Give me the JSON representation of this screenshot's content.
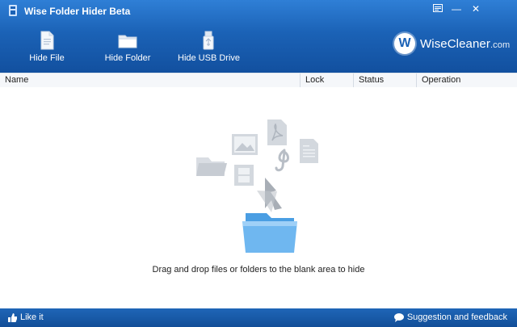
{
  "window": {
    "title": "Wise Folder Hider Beta",
    "controls": {
      "menu": "menu-icon",
      "minimize": "—",
      "close": "✕"
    }
  },
  "toolbar": {
    "hide_file": "Hide File",
    "hide_folder": "Hide Folder",
    "hide_usb": "Hide USB Drive"
  },
  "brand": {
    "badge": "W",
    "name": "WiseCleaner",
    "domain": ".com"
  },
  "list": {
    "columns": [
      "Name",
      "Lock",
      "Status",
      "Operation"
    ]
  },
  "main": {
    "hint": "Drag and drop files or folders to the blank area to hide",
    "illustration_icons": [
      "folder-icon",
      "image-icon",
      "pdf-icon",
      "music-icon",
      "document-icon",
      "film-icon",
      "down-arrow-icon",
      "blue-folder-icon"
    ]
  },
  "footer": {
    "like": "Like it",
    "feedback": "Suggestion and feedback"
  },
  "colors": {
    "header_top": "#2f7fd6",
    "header_bottom": "#12509f",
    "footer": "#1b5aa7"
  }
}
